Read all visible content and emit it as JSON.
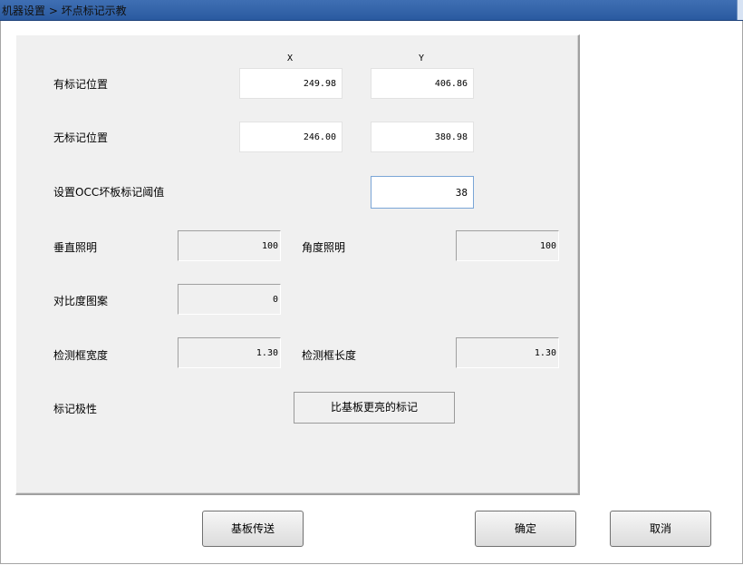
{
  "window": {
    "title": "机器设置 > 坏点标记示教"
  },
  "columns": {
    "x": "X",
    "y": "Y"
  },
  "mark_position": {
    "label": "有标记位置",
    "x": "249.98",
    "y": "406.86"
  },
  "no_mark_position": {
    "label": "无标记位置",
    "x": "246.00",
    "y": "380.98"
  },
  "threshold": {
    "label": "设置OCC坏板标记阈值",
    "value": "38"
  },
  "vertical_light": {
    "label": "垂直照明",
    "value": "100"
  },
  "angle_light": {
    "label": "角度照明",
    "value": "100"
  },
  "contrast": {
    "label": "对比度图案",
    "value": "0"
  },
  "detect_width": {
    "label": "检测框宽度",
    "value": "1.30"
  },
  "detect_length": {
    "label": "检测框长度",
    "value": "1.30"
  },
  "polarity": {
    "label": "标记极性",
    "value": "比基板更亮的标记"
  },
  "buttons": {
    "transfer": "基板传送",
    "ok": "确定",
    "cancel": "取消"
  }
}
